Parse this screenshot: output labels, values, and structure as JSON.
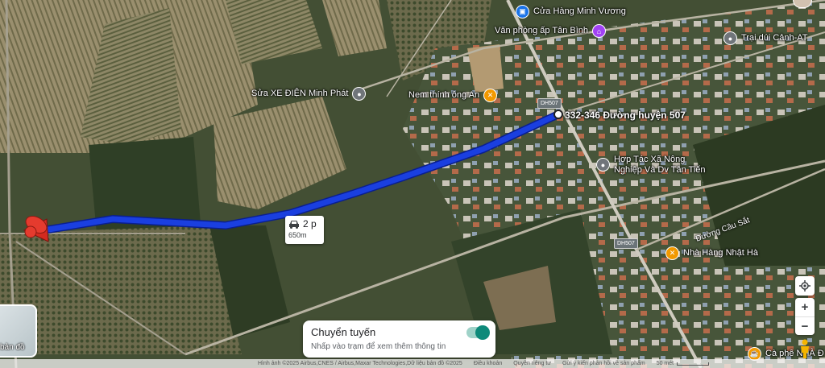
{
  "map": {
    "pois": [
      {
        "key": "cua-hang",
        "label": "Cửa Hàng Minh Vương",
        "icon": "shopping-bag-icon",
        "color": "#1a73e8",
        "side": "right"
      },
      {
        "key": "van-phong",
        "label": "Văn phòng ấp Tân Bình",
        "icon": "government-building-icon",
        "color": "#a142f4",
        "side": "left"
      },
      {
        "key": "trai-dui",
        "label": "Trại dúi Cảnh-AT",
        "icon": "place-icon",
        "color": "#70757a",
        "side": "right"
      },
      {
        "key": "sua-xe",
        "label": "Sửa XE ĐIỆN Minh Phát",
        "icon": "place-icon",
        "color": "#70757a",
        "side": "left"
      },
      {
        "key": "nem-thinh",
        "label": "Nem thính ông An",
        "icon": "restaurant-icon",
        "color": "#f29900",
        "side": "left"
      },
      {
        "key": "hop-tac-xa",
        "label": "Hợp Tác Xã Nông\nNghiệp Và Dv Tân Tiến",
        "icon": "place-icon",
        "color": "#70757a",
        "side": "right"
      },
      {
        "key": "nha-hang",
        "label": "Nhà Hàng Nhật Hà",
        "icon": "restaurant-icon",
        "color": "#f29900",
        "side": "right"
      },
      {
        "key": "ca-phe",
        "label": "Cà phê NHÀ Đ",
        "icon": "cafe-icon",
        "color": "#f29900",
        "side": "right"
      }
    ],
    "road_shields": [
      "DH507",
      "DH507"
    ],
    "road_names": [
      "Đường Cầu Sắt"
    ],
    "destination_label": "332-346 Đường huyện 507",
    "route_color": "#1a3fe0"
  },
  "route_info": {
    "icon": "car-icon",
    "duration": "2 p",
    "distance": "650m"
  },
  "transit_card": {
    "title": "Chuyển tuyến",
    "subtitle": "Nhấp vào trạm để xem thêm thông tin",
    "toggle_on": true,
    "accent": "#0d8a7a"
  },
  "layer_switch": {
    "label": "bản đồ"
  },
  "attribution": {
    "imagery": "Hình ảnh ©2025 Airbus,CNES / Airbus,Maxar Technologies,Dữ liệu bản đồ ©2025",
    "links": [
      "Điều khoản",
      "Quyền riêng tư",
      "Gửi ý kiến phản hồi về sản phẩm"
    ],
    "scale": "50 mét"
  }
}
